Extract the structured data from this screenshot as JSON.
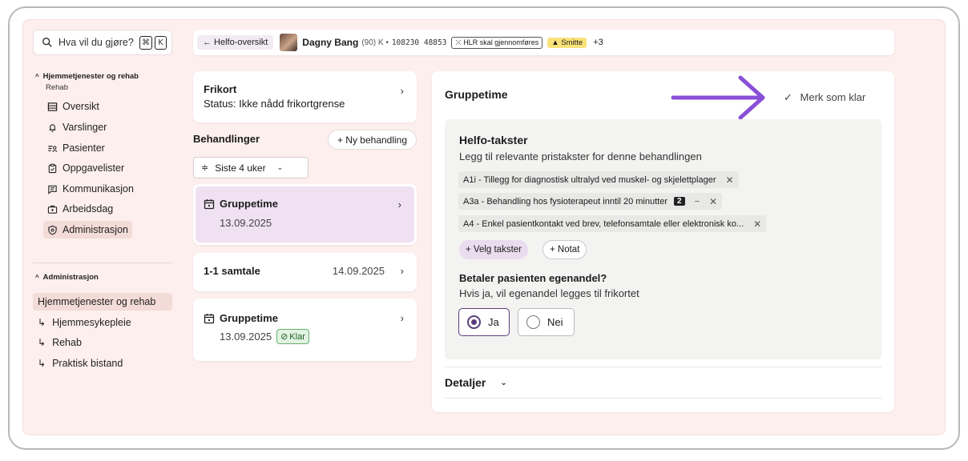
{
  "search": {
    "placeholder": "Hva vil du gjøre?",
    "kbd1": "⌘",
    "kbd2": "K"
  },
  "sidebar": {
    "section1": {
      "title": "Hjemmetjenester og rehab",
      "subtitle": "Rehab"
    },
    "items": [
      {
        "label": "Oversikt",
        "icon": "list-icon"
      },
      {
        "label": "Varslinger",
        "icon": "bell-icon"
      },
      {
        "label": "Pasienter",
        "icon": "patients-icon"
      },
      {
        "label": "Oppgavelister",
        "icon": "clipboard-icon"
      },
      {
        "label": "Kommunikasjon",
        "icon": "message-icon"
      },
      {
        "label": "Arbeidsdag",
        "icon": "briefcase-icon"
      },
      {
        "label": "Administrasjon",
        "icon": "shield-icon"
      }
    ],
    "section2": {
      "title": "Administrasjon"
    },
    "tree": [
      "Hjemmetjenester og rehab",
      "Hjemmesykepleie",
      "Rehab",
      "Praktisk bistand"
    ]
  },
  "topbar": {
    "back": "← Helfo-oversikt",
    "name": "Dagny Bang",
    "meta": "(90) K •",
    "id": "108230 48853",
    "hlr": "HLR skal gjennomføres",
    "smitte": "Smitte",
    "more": "+3"
  },
  "frikort": {
    "title": "Frikort",
    "status": "Status: Ikke nådd frikortgrense"
  },
  "behandlinger": {
    "title": "Behandlinger",
    "new_button": "+ Ny behandling",
    "filter": "Siste 4 uker",
    "items": [
      {
        "title": "Gruppetime",
        "date": "13.09.2025"
      },
      {
        "title": "1-1 samtale",
        "date": "14.09.2025"
      },
      {
        "title": "Gruppetime",
        "date": "13.09.2025",
        "badge": "Klar"
      }
    ]
  },
  "main": {
    "title": "Gruppetime",
    "mark_done": "Merk som klar",
    "helfo_title": "Helfo-takster",
    "helfo_subtitle": "Legg til relevante pristakster for denne behandlingen",
    "chips": [
      {
        "label": "A1i - Tillegg for diagnostisk ultralyd ved muskel- og skjelettplager"
      },
      {
        "label": "A3a - Behandling hos fysioterapeut inntil 20 minutter",
        "qty": "2"
      },
      {
        "label": "A4 - Enkel pasientkontakt ved brev, telefonsamtale eller elektronisk ko..."
      }
    ],
    "select_button": "+ Velg takster",
    "note_button": "+ Notat",
    "question_title": "Betaler pasienten egenandel?",
    "question_sub": "Hvis ja, vil egenandel legges til frikortet",
    "yes": "Ja",
    "no": "Nei",
    "details": "Detaljer"
  },
  "colors": {
    "accent": "#8a4fd8",
    "selected": "#efe1f2",
    "background": "#fcefed"
  }
}
